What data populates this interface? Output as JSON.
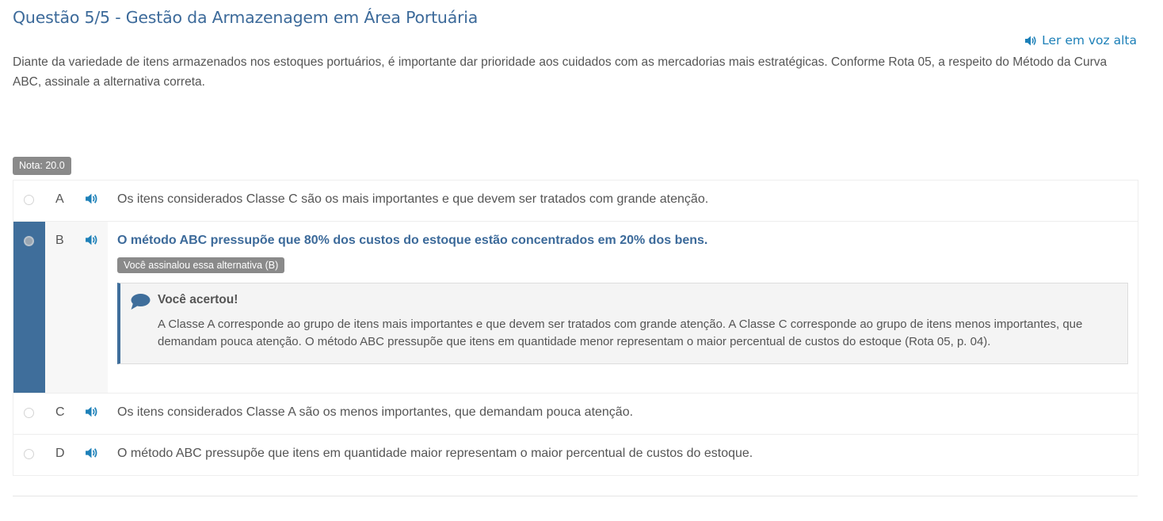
{
  "question": {
    "title": "Questão 5/5 - Gestão da Armazenagem em Área Portuária",
    "tts_label": "Ler em voz alta",
    "text": "Diante da variedade de itens armazenados nos estoques portuários, é importante dar prioridade aos cuidados com as mercadorias mais estratégicas. Conforme Rota 05, a respeito do Método da Curva ABC, assinale a alternativa correta.",
    "grade": "Nota: 20.0"
  },
  "options": [
    {
      "letter": "A",
      "text": "Os itens considerados Classe C são os mais importantes e que devem ser tratados com grande atenção.",
      "selected": false
    },
    {
      "letter": "B",
      "text": "O método ABC pressupõe que 80% dos custos do estoque estão concentrados em 20% dos bens.",
      "selected": true,
      "selected_badge": "Você assinalou essa alternativa (B)",
      "feedback_title": "Você acertou!",
      "feedback_text": "A Classe A corresponde ao grupo de itens mais importantes e que devem ser tratados com grande atenção. A Classe C corresponde ao grupo de itens menos importantes, que demandam pouca atenção. O método ABC pressupõe que itens em quantidade menor representam o maior percentual de custos do estoque (Rota 05, p. 04)."
    },
    {
      "letter": "C",
      "text": "Os itens considerados Classe A são os menos importantes, que demandam pouca atenção.",
      "selected": false
    },
    {
      "letter": "D",
      "text": "O método ABC pressupõe que itens em quantidade maior representam o maior percentual de custos do estoque.",
      "selected": false
    }
  ],
  "icons": {
    "tts": "speaker-icon",
    "option_tts": "speaker-icon",
    "feedback": "speech-bubble-icon"
  },
  "colors": {
    "title": "#3c6a9a",
    "link": "#1d80b8",
    "selected_bar": "#3f6e9b",
    "badge": "#8a8a8a"
  }
}
